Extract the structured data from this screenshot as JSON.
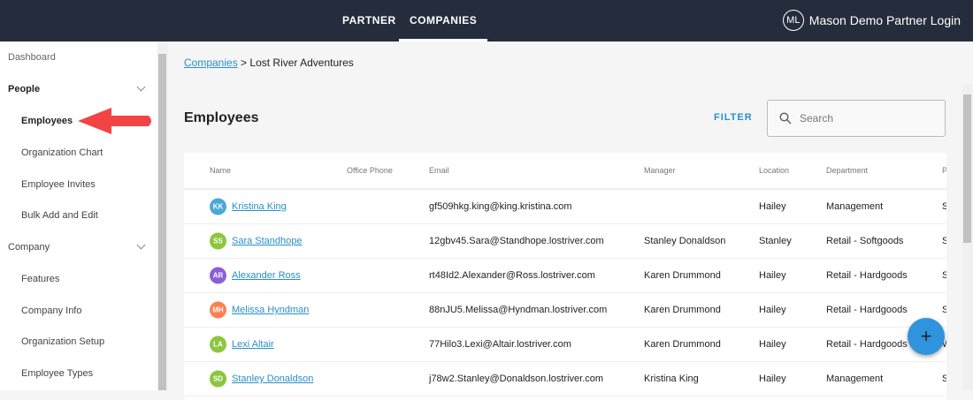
{
  "topnav": {
    "items": [
      {
        "label": "PARTNER"
      },
      {
        "label": "COMPANIES"
      }
    ],
    "active": "COMPANIES",
    "user_initials": "ML",
    "user_name": "Mason Demo Partner Login"
  },
  "sidebar": {
    "items": [
      {
        "label": "Dashboard"
      },
      {
        "label": "People"
      },
      {
        "label": "Employees"
      },
      {
        "label": "Organization Chart"
      },
      {
        "label": "Employee Invites"
      },
      {
        "label": "Bulk Add and Edit"
      },
      {
        "label": "Company"
      },
      {
        "label": "Features"
      },
      {
        "label": "Company Info"
      },
      {
        "label": "Organization Setup"
      },
      {
        "label": "Employee Types"
      }
    ]
  },
  "breadcrumb": {
    "link": "Companies",
    "separator": ">",
    "current": "Lost River Adventures"
  },
  "page": {
    "title": "Employees",
    "filter_label": "FILTER",
    "search_placeholder": "Search"
  },
  "table": {
    "columns": [
      "Name",
      "Office Phone",
      "Email",
      "Manager",
      "Location",
      "Department",
      "P"
    ],
    "rows": [
      {
        "initials": "KK",
        "color": "#4aa8d8",
        "name": "Kristina King",
        "phone": "",
        "email": "gf509hkg.king@king.kristina.com",
        "manager": "",
        "location": "Hailey",
        "department": "Management",
        "extra": "S"
      },
      {
        "initials": "SS",
        "color": "#8cc63f",
        "name": "Sara Standhope",
        "phone": "",
        "email": "12gbv45.Sara@Standhope.lostriver.com",
        "manager": "Stanley Donaldson",
        "location": "Stanley",
        "department": "Retail - Softgoods",
        "extra": "S"
      },
      {
        "initials": "AR",
        "color": "#8a5fd6",
        "name": "Alexander Ross",
        "phone": "",
        "email": "rt48Id2.Alexander@Ross.lostriver.com",
        "manager": "Karen Drummond",
        "location": "Hailey",
        "department": "Retail - Hardgoods",
        "extra": "S"
      },
      {
        "initials": "MH",
        "color": "#ff7f50",
        "name": "Melissa Hyndman",
        "phone": "",
        "email": "88nJU5.Melissa@Hyndman.lostriver.com",
        "manager": "Karen Drummond",
        "location": "Hailey",
        "department": "Retail - Hardgoods",
        "extra": "S"
      },
      {
        "initials": "LA",
        "color": "#8cc63f",
        "name": "Lexi Altair",
        "phone": "",
        "email": "77Hilo3.Lexi@Altair.lostriver.com",
        "manager": "Karen Drummond",
        "location": "Hailey",
        "department": "Retail - Hardgoods",
        "extra": "W"
      },
      {
        "initials": "SD",
        "color": "#8cc63f",
        "name": "Stanley Donaldson",
        "phone": "",
        "email": "j78w2.Stanley@Donaldson.lostriver.com",
        "manager": "Kristina King",
        "location": "Hailey",
        "department": "Management",
        "extra": "S"
      }
    ]
  },
  "fab": {
    "label": "+"
  }
}
